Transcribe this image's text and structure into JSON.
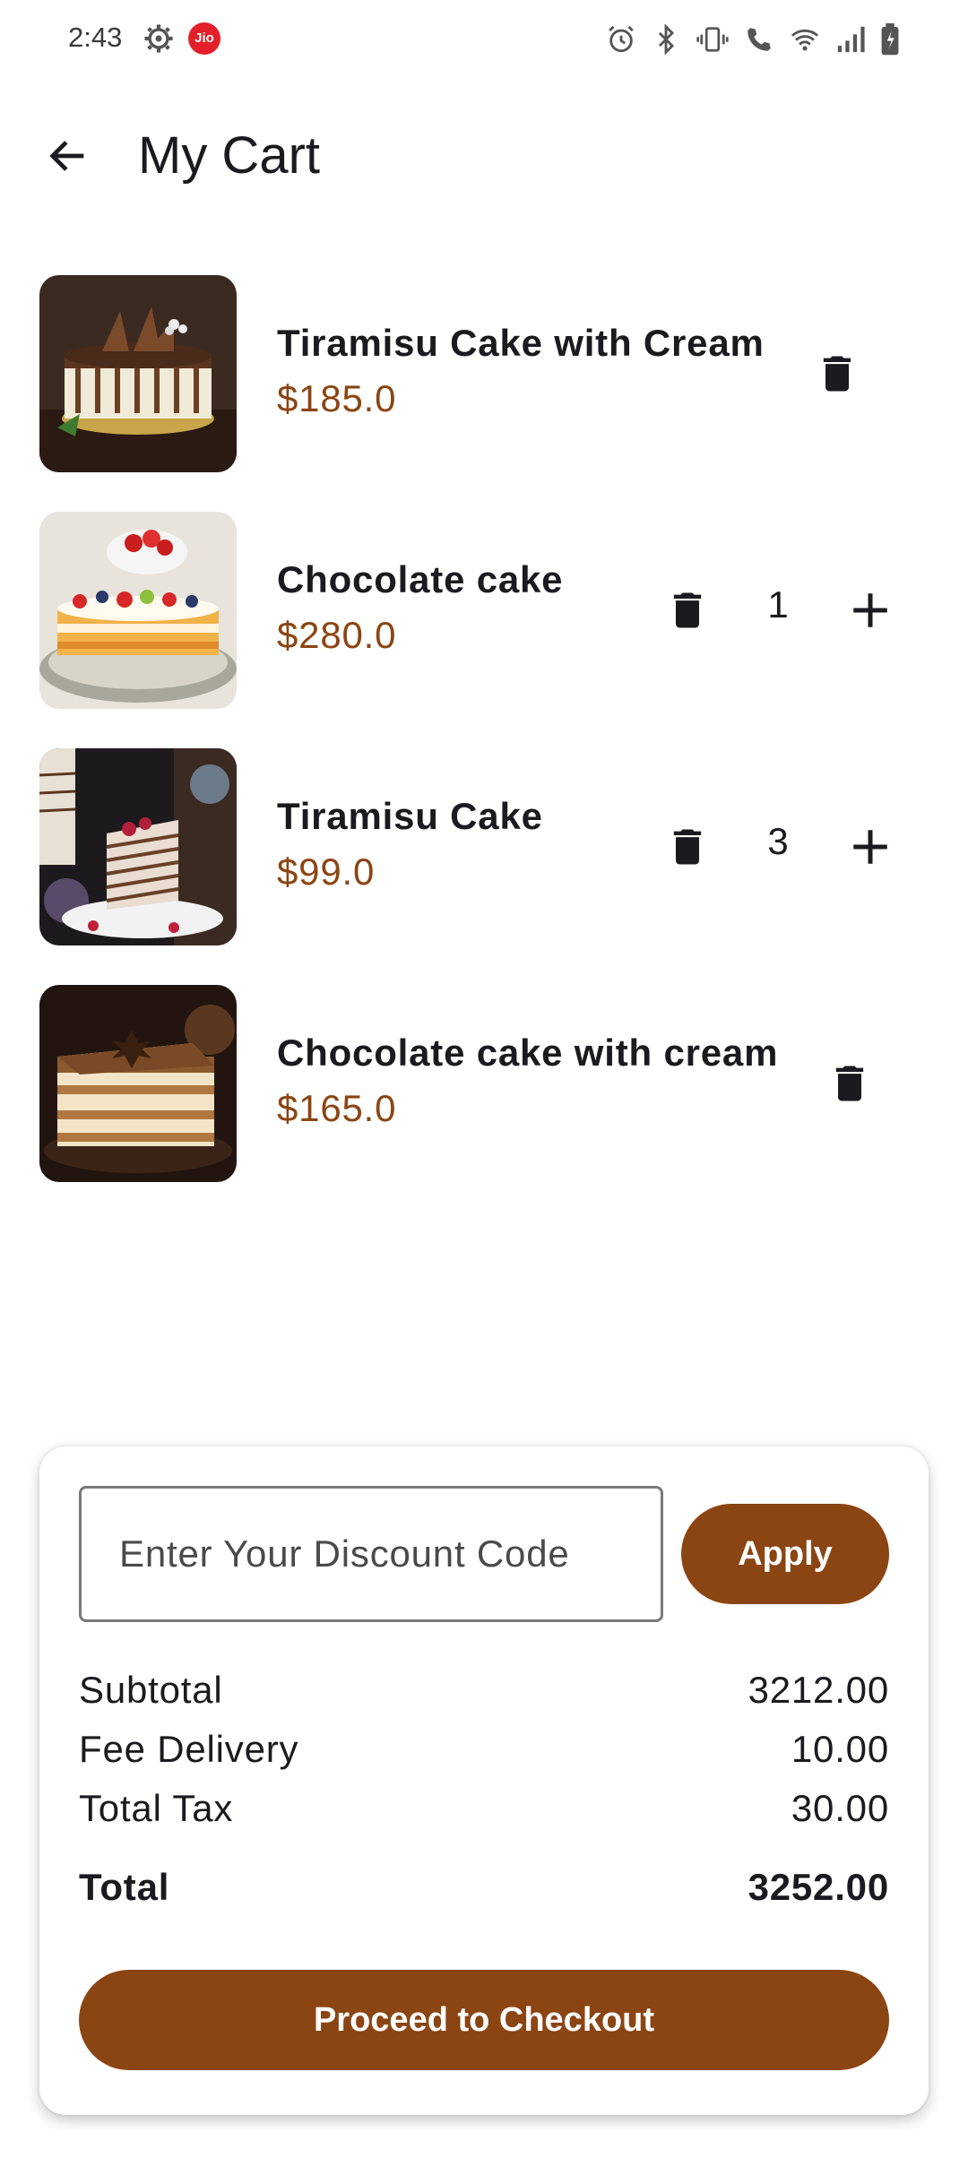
{
  "status_bar": {
    "time": "2:43",
    "carrier_badge": "Jio",
    "icons": [
      "settings-icon",
      "alarm-icon",
      "bluetooth-icon",
      "vibrate-icon",
      "wifi-calling-icon",
      "wifi-icon",
      "signal-icon",
      "battery-icon"
    ]
  },
  "app_bar": {
    "title": "My Cart",
    "back_icon": "arrow-left-icon"
  },
  "cart": {
    "items": [
      {
        "name": "Tiramisu Cake with Cream",
        "price": "$185.0",
        "image": "tiramisu-cake-with-cream-photo"
      },
      {
        "name": "Chocolate cake",
        "price": "$280.0",
        "quantity": "1",
        "image": "chocolate-cake-photo"
      },
      {
        "name": "Tiramisu Cake",
        "price": "$99.0",
        "quantity": "3",
        "image": "tiramisu-cake-photo"
      },
      {
        "name": "Chocolate cake with cream",
        "price": "$165.0",
        "image": "chocolate-cake-with-cream-photo"
      }
    ]
  },
  "summary": {
    "discount_placeholder": "Enter Your Discount Code",
    "apply_label": "Apply",
    "subtotal_label": "Subtotal",
    "subtotal_value": "3212.00",
    "delivery_label": "Fee Delivery",
    "delivery_value": "10.00",
    "tax_label": "Total Tax",
    "tax_value": "30.00",
    "total_label": "Total",
    "total_value": "3252.00",
    "checkout_label": "Proceed to Checkout"
  },
  "colors": {
    "accent": "#8B4513",
    "text": "#1B1B1F",
    "background": "#FFFFFF"
  }
}
